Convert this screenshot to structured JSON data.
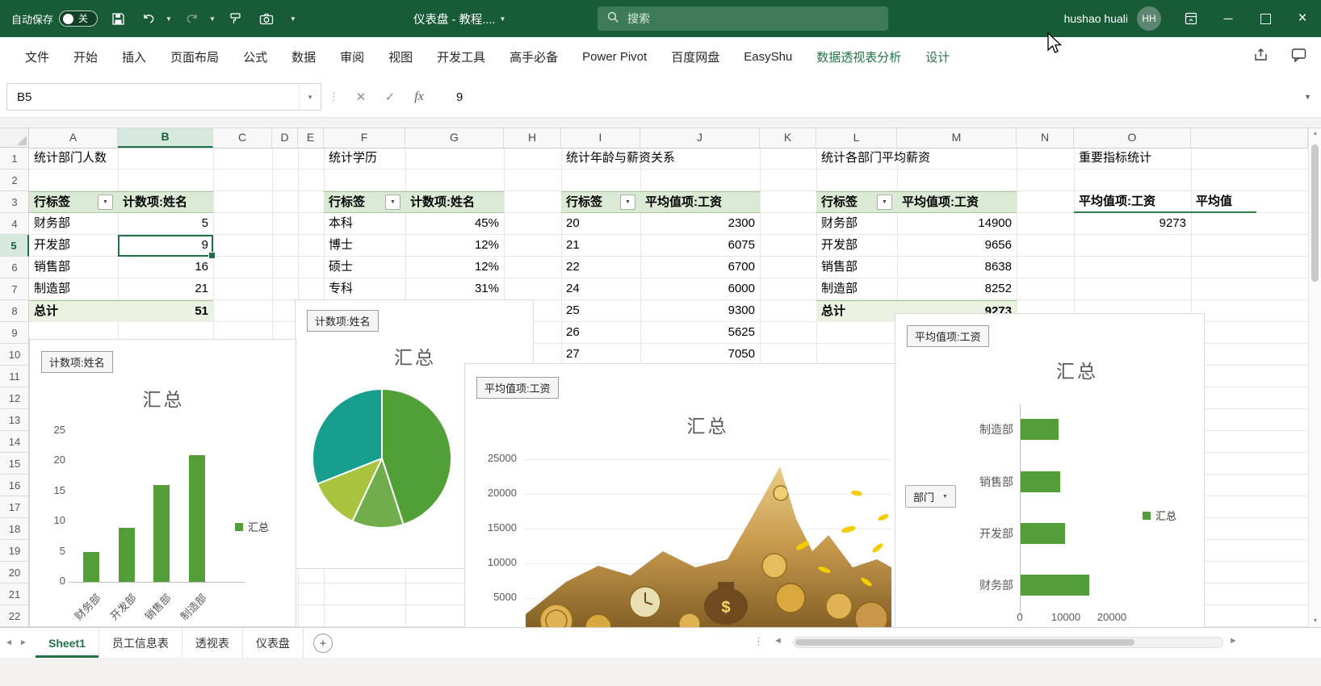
{
  "titlebar": {
    "autosave_label": "自动保存",
    "autosave_state": "关",
    "doc_title": "仪表盘 - 教程....",
    "search_placeholder": "搜索",
    "user_name": "hushao huali",
    "avatar_initials": "HH"
  },
  "ribbon": {
    "tabs": [
      "文件",
      "开始",
      "插入",
      "页面布局",
      "公式",
      "数据",
      "审阅",
      "视图",
      "开发工具",
      "高手必备",
      "Power Pivot",
      "百度网盘",
      "EasyShu",
      "数据透视表分析",
      "设计"
    ],
    "accent_tabs": [
      "数据透视表分析",
      "设计"
    ]
  },
  "formula_bar": {
    "name_box": "B5",
    "fx_label": "fx",
    "formula_value": "9"
  },
  "sheet": {
    "columns": [
      "A",
      "B",
      "C",
      "D",
      "E",
      "F",
      "G",
      "H",
      "I",
      "J",
      "K",
      "L",
      "M",
      "N",
      "O",
      ""
    ],
    "rows": [
      "1",
      "2",
      "3",
      "4",
      "5",
      "6",
      "7",
      "8",
      "9",
      "10",
      "11",
      "12",
      "13",
      "14",
      "15",
      "16",
      "17",
      "18",
      "19",
      "20",
      "21",
      "22"
    ],
    "selected": {
      "col": "B",
      "row": "5"
    }
  },
  "pivot_tables": {
    "dept_count": {
      "title": "统计部门人数",
      "headers": [
        "行标签",
        "计数项:姓名"
      ],
      "rows": [
        [
          "财务部",
          "5"
        ],
        [
          "开发部",
          "9"
        ],
        [
          "销售部",
          "16"
        ],
        [
          "制造部",
          "21"
        ]
      ],
      "total": [
        "总计",
        "51"
      ]
    },
    "education": {
      "title": "统计学历",
      "headers": [
        "行标签",
        "计数项:姓名"
      ],
      "rows": [
        [
          "本科",
          "45%"
        ],
        [
          "博士",
          "12%"
        ],
        [
          "硕士",
          "12%"
        ],
        [
          "专科",
          "31%"
        ]
      ]
    },
    "age_salary": {
      "title": "统计年龄与薪资关系",
      "headers": [
        "行标签",
        "平均值项:工资"
      ],
      "rows": [
        [
          "20",
          "2300"
        ],
        [
          "21",
          "6075"
        ],
        [
          "22",
          "6700"
        ],
        [
          "24",
          "6000"
        ],
        [
          "25",
          "9300"
        ],
        [
          "26",
          "5625"
        ],
        [
          "27",
          "7050"
        ]
      ]
    },
    "dept_salary": {
      "title": "统计各部门平均薪资",
      "headers": [
        "行标签",
        "平均值项:工资"
      ],
      "rows": [
        [
          "财务部",
          "14900"
        ],
        [
          "开发部",
          "9656"
        ],
        [
          "销售部",
          "8638"
        ],
        [
          "制造部",
          "8252"
        ]
      ],
      "total": [
        "总计",
        "9273"
      ]
    },
    "kpi": {
      "title": "重要指标统计",
      "headers": [
        "平均值项:工资",
        "平均值"
      ],
      "value": "9273"
    }
  },
  "chart_data": [
    {
      "type": "bar",
      "name": "dept-count-column-chart",
      "field_button": "计数项:姓名",
      "title": "汇总",
      "categories": [
        "财务部",
        "开发部",
        "销售部",
        "制造部"
      ],
      "values": [
        5,
        9,
        16,
        21
      ],
      "ylim": [
        0,
        25
      ],
      "yticks": [
        0,
        5,
        10,
        15,
        20,
        25
      ],
      "legend": [
        "汇总"
      ],
      "bar_color": "#549E39"
    },
    {
      "type": "pie",
      "name": "education-pie-chart",
      "field_button": "计数项:姓名",
      "title": "汇总",
      "categories": [
        "本科",
        "硕士",
        "博士",
        "专科"
      ],
      "values": [
        45,
        12,
        12,
        31
      ],
      "colors": [
        "#519F37",
        "#6FAE4A",
        "#A9C33E",
        "#169E8F"
      ]
    },
    {
      "type": "area",
      "name": "salary-by-age-area-chart",
      "field_button": "平均值项:工资",
      "title": "汇总",
      "yticks": [
        25000,
        20000,
        15000,
        10000,
        5000
      ],
      "fill": "picture-fill-money-collage"
    },
    {
      "type": "hbar",
      "name": "dept-salary-bar-chart",
      "field_button": "平均值项:工资",
      "filter_button": "部门",
      "title": "汇总",
      "categories": [
        "制造部",
        "销售部",
        "开发部",
        "财务部"
      ],
      "values": [
        8252,
        8638,
        9656,
        14900
      ],
      "xticks": [
        0,
        10000,
        20000
      ],
      "legend": [
        "汇总"
      ],
      "bar_color": "#549E39"
    }
  ],
  "sheet_tabs": {
    "tabs": [
      "Sheet1",
      "员工信息表",
      "透视表",
      "仪表盘"
    ],
    "active": "Sheet1",
    "add_label": "+"
  },
  "colors": {
    "titlebar": "#185C37",
    "accent": "#217346",
    "pivot_header_bg": "#DBEAD5",
    "pivot_total_bg": "#EAF2E2",
    "bar_green": "#549E39",
    "teal": "#169E8F",
    "yellow_green": "#A9C33E"
  }
}
